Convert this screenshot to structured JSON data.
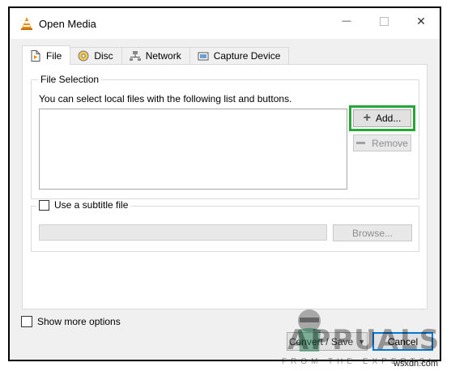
{
  "window": {
    "title": "Open Media",
    "minimize": "—",
    "close": "✕"
  },
  "tabs": [
    {
      "label": "File",
      "icon": "file-icon",
      "active": true
    },
    {
      "label": "Disc",
      "icon": "disc-icon",
      "active": false
    },
    {
      "label": "Network",
      "icon": "network-icon",
      "active": false
    },
    {
      "label": "Capture Device",
      "icon": "capture-device-icon",
      "active": false
    }
  ],
  "file_selection": {
    "title": "File Selection",
    "description": "You can select local files with the following list and buttons.",
    "add_label": "Add...",
    "remove_label": "Remove",
    "highlight_color": "#26a637"
  },
  "subtitle": {
    "label": "Use a subtitle file",
    "checked": false,
    "browse_label": "Browse..."
  },
  "options": {
    "show_more_label": "Show more options",
    "checked": false
  },
  "footer": {
    "convert_label": "Convert / Save",
    "cancel_label": "Cancel"
  },
  "watermark": {
    "brand": "APPUALS",
    "tagline": "FROM THE EXPERTS!",
    "site": "wsxdn.com"
  }
}
